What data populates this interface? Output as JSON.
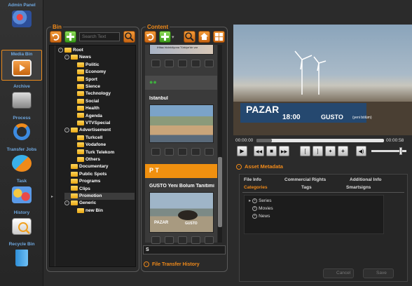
{
  "nav": {
    "items": [
      {
        "label": "Admin Panel",
        "icon": "users-icon",
        "active": false
      },
      {
        "label": "Media Bin",
        "icon": "film-icon",
        "active": true
      },
      {
        "label": "Archive",
        "icon": "archive-icon",
        "active": false
      },
      {
        "label": "Process",
        "icon": "process-icon",
        "active": false
      },
      {
        "label": "Transfer Jobs",
        "icon": "transfer-icon",
        "active": false
      },
      {
        "label": "Task",
        "icon": "task-icon",
        "active": false
      },
      {
        "label": "History",
        "icon": "history-icon",
        "active": false
      },
      {
        "label": "Recycle Bin",
        "icon": "trash-icon",
        "active": false
      }
    ]
  },
  "bin": {
    "title": "Bin",
    "search_placeholder": "Search Text",
    "tree": [
      {
        "label": "Root",
        "level": 0,
        "expander": true,
        "folder": true
      },
      {
        "label": "News",
        "level": 1,
        "expander": true,
        "folder": true
      },
      {
        "label": "Politic",
        "level": 2,
        "expander": false,
        "folder": true
      },
      {
        "label": "Economy",
        "level": 2,
        "expander": false,
        "folder": true
      },
      {
        "label": "Sport",
        "level": 2,
        "expander": false,
        "folder": true
      },
      {
        "label": "Sience",
        "level": 2,
        "expander": false,
        "folder": true
      },
      {
        "label": "Technology",
        "level": 2,
        "expander": false,
        "folder": true
      },
      {
        "label": "Social",
        "level": 2,
        "expander": false,
        "folder": true
      },
      {
        "label": "Health",
        "level": 2,
        "expander": false,
        "folder": true
      },
      {
        "label": "Agenda",
        "level": 2,
        "expander": false,
        "folder": true
      },
      {
        "label": "VTVSpecial",
        "level": 2,
        "expander": false,
        "folder": true
      },
      {
        "label": "Advertisement",
        "level": 1,
        "expander": true,
        "folder": true
      },
      {
        "label": "Turkcell",
        "level": 2,
        "expander": false,
        "folder": true
      },
      {
        "label": "Vodafone",
        "level": 2,
        "expander": false,
        "folder": true
      },
      {
        "label": "Turk Telekom",
        "level": 2,
        "expander": false,
        "folder": true
      },
      {
        "label": "Others",
        "level": 2,
        "expander": false,
        "folder": true
      },
      {
        "label": "Documentary",
        "level": 1,
        "expander": false,
        "folder": true
      },
      {
        "label": "Public Spots",
        "level": 1,
        "expander": false,
        "folder": true
      },
      {
        "label": "Programs",
        "level": 1,
        "expander": false,
        "folder": true
      },
      {
        "label": "Clips",
        "level": 1,
        "expander": false,
        "folder": true
      },
      {
        "label": "Promotion",
        "level": 1,
        "expander": false,
        "folder": true,
        "selected": true
      },
      {
        "label": "Generic",
        "level": 1,
        "expander": true,
        "folder": true
      },
      {
        "label": "new Bin",
        "level": 2,
        "expander": false,
        "folder": true
      }
    ]
  },
  "content": {
    "title": "Content",
    "cards": [
      {
        "title": "Istanbul",
        "tags": "",
        "header_color": "#4a4a4a"
      },
      {
        "title": "GUSTO Yeni Bolum Tanitimi",
        "tags": "P  T",
        "header_color": "#f0900f"
      }
    ],
    "top_thumb_caption": "iHitac hicinidiyona Türkiye'de var",
    "thumb_overlay_text": "PAZAR",
    "thumb_overlay_sub": "GUSTO",
    "filter_value": "S",
    "file_transfer_history": "File Transfer History"
  },
  "player": {
    "overlay_day": "PAZAR",
    "overlay_time": "18:00",
    "overlay_show": "GUSTO",
    "overlay_note": "(yeni bölüm)",
    "time_current": "00:00:00",
    "time_total": "00:00:58",
    "progress": 0.12,
    "volume": 0.8
  },
  "metadata": {
    "title": "Asset Metadata",
    "tabs_row1": [
      "File Info",
      "Commercial Rights",
      "Additional Info"
    ],
    "tabs_row2": [
      "Categories",
      "Tags",
      "Smartsigns"
    ],
    "active_tab": "Categories",
    "categories": [
      {
        "label": "Series",
        "expanded": false
      },
      {
        "label": "Movies",
        "expanded": false
      },
      {
        "label": "News",
        "expanded": false
      }
    ],
    "cancel_label": "Cancel",
    "save_label": "Save"
  }
}
